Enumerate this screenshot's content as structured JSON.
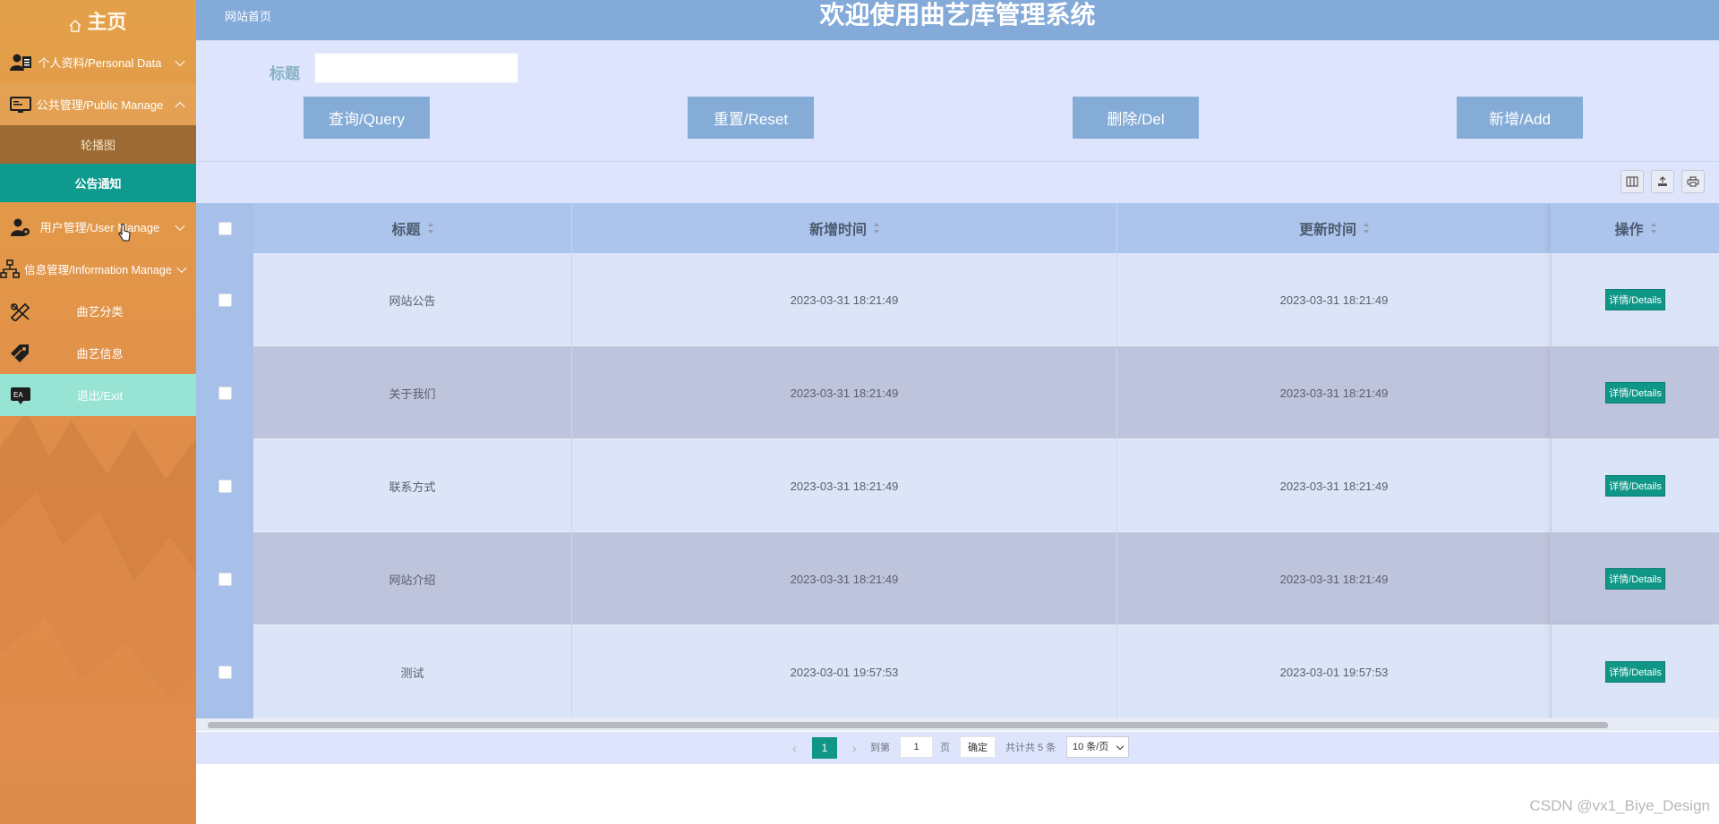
{
  "sidebar": {
    "home": "主页",
    "items": [
      {
        "label": "个人资料/Personal Data",
        "icon": "user-card-icon"
      },
      {
        "label": "公共管理/Public Manage",
        "icon": "monitor-icon"
      },
      {
        "label": "用户管理/User Manage",
        "icon": "user-gear-icon"
      },
      {
        "label": "信息管理/Information Manage",
        "icon": "org-chart-icon"
      },
      {
        "label": "曲艺分类",
        "icon": "pencil-ruler-icon"
      },
      {
        "label": "曲艺信息",
        "icon": "tags-icon"
      },
      {
        "label": "退出/Exit",
        "icon": "exit-chat-icon"
      }
    ],
    "sub_items": [
      {
        "label": "轮播图"
      },
      {
        "label": "公告通知"
      }
    ]
  },
  "topbar": {
    "breadcrumb": "网站首页",
    "title": "欢迎使用曲艺库管理系统"
  },
  "search": {
    "label": "标题",
    "value": "",
    "buttons": {
      "query": "查询/Query",
      "reset": "重置/Reset",
      "delete": "删除/Del",
      "add": "新增/Add"
    }
  },
  "table": {
    "columns": [
      "标题",
      "新增时间",
      "更新时间",
      "操作"
    ],
    "rows": [
      {
        "title": "网站公告",
        "created": "2023-03-31 18:21:49",
        "updated": "2023-03-31 18:21:49",
        "action": "详情/Details"
      },
      {
        "title": "关于我们",
        "created": "2023-03-31 18:21:49",
        "updated": "2023-03-31 18:21:49",
        "action": "详情/Details"
      },
      {
        "title": "联系方式",
        "created": "2023-03-31 18:21:49",
        "updated": "2023-03-31 18:21:49",
        "action": "详情/Details"
      },
      {
        "title": "网站介绍",
        "created": "2023-03-31 18:21:49",
        "updated": "2023-03-31 18:21:49",
        "action": "详情/Details"
      },
      {
        "title": "测试",
        "created": "2023-03-01 19:57:53",
        "updated": "2023-03-01 19:57:53",
        "action": "详情/Details"
      }
    ]
  },
  "pagination": {
    "current_page": "1",
    "goto_prefix": "到第",
    "goto_value": "1",
    "goto_suffix": "页",
    "confirm": "确定",
    "total": "共计共 5 条",
    "page_size": "10 条/页"
  },
  "watermark": "CSDN @vx1_Biye_Design",
  "colors": {
    "sidebar": "#e29549",
    "topbar": "#83aad8",
    "content_bg": "#dde4fb",
    "accent": "#0f9686",
    "button": "#84acd6"
  }
}
